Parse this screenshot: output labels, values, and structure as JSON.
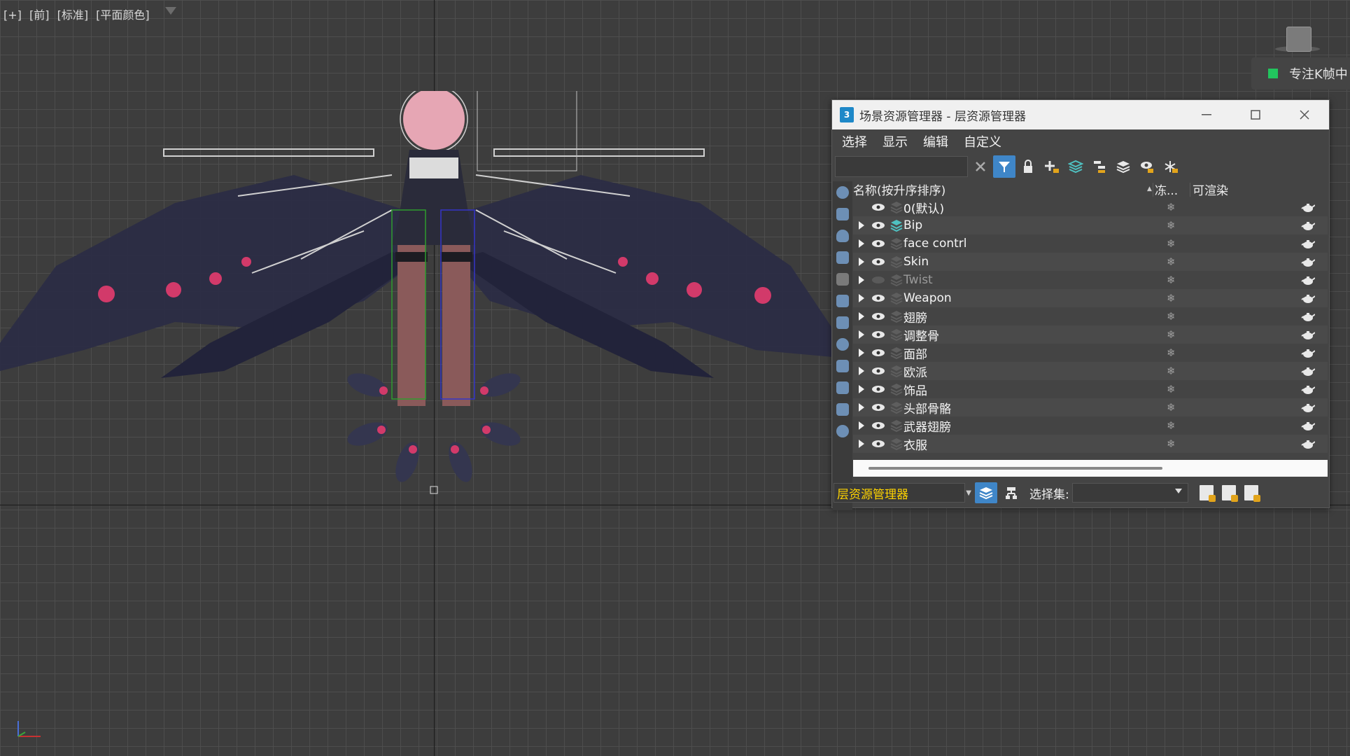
{
  "viewport": {
    "label_parts": [
      "[+]",
      "[前]",
      "[标准]",
      "[平面颜色]"
    ]
  },
  "notice": {
    "text": "专注K帧中"
  },
  "explorer": {
    "title": "场景资源管理器 - 层资源管理器",
    "app_icon_text": "3",
    "menus": [
      "选择",
      "显示",
      "编辑",
      "自定义"
    ],
    "search": {
      "value": "",
      "placeholder": ""
    },
    "columns": {
      "name": "名称(按升序排序)",
      "freeze": "冻...",
      "renderable": "可渲染"
    },
    "layers": [
      {
        "name": "0(默认)",
        "expandable": false,
        "visible": true,
        "dim": false
      },
      {
        "name": "Bip",
        "expandable": true,
        "visible": true,
        "dim": false,
        "active": true
      },
      {
        "name": "face contrl",
        "expandable": true,
        "visible": true,
        "dim": false
      },
      {
        "name": "Skin",
        "expandable": true,
        "visible": true,
        "dim": false
      },
      {
        "name": "Twist",
        "expandable": true,
        "visible": false,
        "dim": true
      },
      {
        "name": "Weapon",
        "expandable": true,
        "visible": true,
        "dim": false
      },
      {
        "name": "翅膀",
        "expandable": true,
        "visible": true,
        "dim": false
      },
      {
        "name": "调整骨",
        "expandable": true,
        "visible": true,
        "dim": false
      },
      {
        "name": "面部",
        "expandable": true,
        "visible": true,
        "dim": false
      },
      {
        "name": "欧派",
        "expandable": true,
        "visible": true,
        "dim": false
      },
      {
        "name": "饰品",
        "expandable": true,
        "visible": true,
        "dim": false
      },
      {
        "name": "头部骨骼",
        "expandable": true,
        "visible": true,
        "dim": false
      },
      {
        "name": "武器翅膀",
        "expandable": true,
        "visible": true,
        "dim": false
      },
      {
        "name": "衣服",
        "expandable": true,
        "visible": true,
        "dim": false
      }
    ],
    "status": {
      "explorer_name": "层资源管理器",
      "selection_set_label": "选择集:",
      "selection_set_value": ""
    }
  },
  "colors": {
    "accent": "#3f86c8",
    "layer_name_highlight": "#ffd400",
    "notice_square": "#22c55e"
  }
}
